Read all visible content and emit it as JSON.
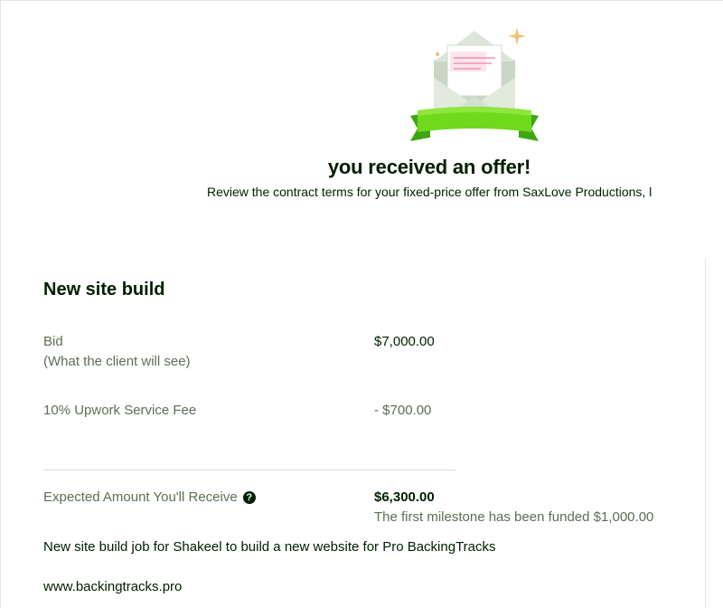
{
  "hero": {
    "title": "you received an offer!",
    "subtitle": "Review the contract terms for your fixed-price offer from SaxLove Productions, l"
  },
  "offer": {
    "title": "New site build",
    "bid_label": "Bid",
    "bid_sublabel": "(What the client will see)",
    "bid_value": "$7,000.00",
    "fee_label": "10% Upwork Service Fee",
    "fee_value": "- $700.00",
    "expected_label": "Expected Amount You'll Receive",
    "expected_value": "$6,300.00",
    "milestone_note": "The first milestone has been funded $1,000.00",
    "description": "New site build job for Shakeel to build a new website for Pro BackingTracks",
    "website": "www.backingtracks.pro"
  },
  "icons": {
    "illustration": "envelope-with-ribbon-icon",
    "help": "question-circle-icon"
  },
  "colors": {
    "ribbon_green": "#6fda1c",
    "ribbon_dark": "#3fa510",
    "envelope": "#d5e2d2",
    "letter_lines": "#f48fb1",
    "sparkle": "#f2c17a",
    "text": "#001e00",
    "muted_text": "#5e6d55"
  }
}
